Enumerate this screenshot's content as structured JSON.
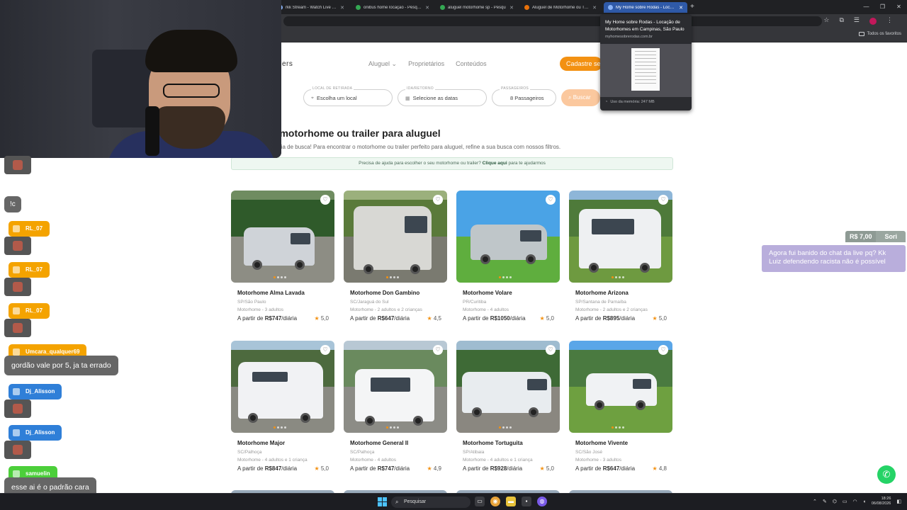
{
  "browser": {
    "tabs": [
      {
        "title": "rkk Stream - Watch Live on Ki",
        "favicon": "globe-icon"
      },
      {
        "title": "onibus home locação - Pesquis",
        "favicon": "google-icon"
      },
      {
        "title": "aluguel motorhome sp - Pesqu",
        "favicon": "google-icon"
      },
      {
        "title": "Aluguel de Motorhome ou Trail",
        "favicon": "site-icon"
      },
      {
        "title": "My Home sobre Rodas - Locaçã",
        "favicon": "globe-icon",
        "active": true
      }
    ],
    "bookmarks_all": "Todos os favoritos",
    "tab_preview": {
      "title": "My Home sobre Rodas - Locação de Motorhomes em Campinas, São Paulo",
      "url": "myhomesobrerodas.com.br",
      "memory": "Uso da memória: 247 MB"
    }
  },
  "site": {
    "logo_fragment": "ers",
    "nav": [
      "Aluguel",
      "Proprietários",
      "Conteúdos"
    ],
    "cta": "Cadastre seu",
    "search": {
      "location": {
        "label": "LOCAL DE RETIRADA",
        "value": "Escolha um local"
      },
      "dates": {
        "label": "IDA/RETORNO",
        "value": "Selecione as datas"
      },
      "passengers": {
        "label": "PASSAGEIROS",
        "value": "8 Passageiros"
      },
      "button": "Buscar"
    },
    "headline": "u motorhome ou trailer para aluguel",
    "subline": "iência de busca! Para encontrar o motorhome ou trailer perfeito para aluguel, refine a sua busca com nossos filtros.",
    "help": {
      "text": "Precisa de ajuda para escolher o seu motorhome ou trailer?",
      "link": "Clique aqui",
      "tail": "para te ajudarmos"
    },
    "price_prefix": "A partir de",
    "price_suffix": "/diária",
    "listings": [
      {
        "title": "Motorhome Alma Lavada",
        "location": "SP/São Paulo",
        "capacity": "Motorhome - 3 adultos",
        "price": "R$747",
        "rating": "5,0"
      },
      {
        "title": "Motorhome Don Gambino",
        "location": "SC/Jaraguá do Sul",
        "capacity": "Motorhome - 2 adultos e 2 crianças",
        "price": "R$647",
        "rating": "4,5"
      },
      {
        "title": "Motorhome Volare",
        "location": "PR/Curitiba",
        "capacity": "Motorhome - 4 adultos",
        "price": "R$1050",
        "rating": "5,0"
      },
      {
        "title": "Motorhome Arizona",
        "location": "SP/Santana de Parnaíba",
        "capacity": "Motorhome - 2 adultos e 2 crianças",
        "price": "R$895",
        "rating": "5,0"
      },
      {
        "title": "Motorhome Major",
        "location": "SC/Palhoça",
        "capacity": "Motorhome - 4 adultos e 1 criança",
        "price": "R$847",
        "rating": "5,0"
      },
      {
        "title": "Motorhome General II",
        "location": "SC/Palhoça",
        "capacity": "Motorhome - 4 adultos",
        "price": "R$747",
        "rating": "4,9"
      },
      {
        "title": "Motorhome Tortuguita",
        "location": "SP/Atibaia",
        "capacity": "Motorhome - 4 adultos e 1 criança",
        "price": "R$928",
        "rating": "5,0"
      },
      {
        "title": "Motorhome Vivente",
        "location": "SC/São José",
        "capacity": "Motorhome - 3 adultos",
        "price": "R$647",
        "rating": "4,8"
      }
    ]
  },
  "stream": {
    "chat": [
      {
        "type": "bubble",
        "text": "!c"
      },
      {
        "type": "user",
        "name": "RL_07",
        "color": "#f4a300"
      },
      {
        "type": "user",
        "name": "RL_07",
        "color": "#f4a300"
      },
      {
        "type": "user",
        "name": "RL_07",
        "color": "#f4a300"
      },
      {
        "type": "user",
        "name": "Umcara_qualquer69",
        "color": "#f4a300"
      },
      {
        "type": "bubble",
        "text": "gordão vale por 5, ja ta errado"
      },
      {
        "type": "user",
        "name": "Dj_Alisson",
        "color": "#2f7fd8"
      },
      {
        "type": "user",
        "name": "Dj_Alisson",
        "color": "#2f7fd8"
      },
      {
        "type": "user",
        "name": "samuelin",
        "color": "#4ccf3a"
      },
      {
        "type": "bubble",
        "text": "esse ai é o padrão cara"
      }
    ],
    "donation": {
      "amount": "R$ 7,00",
      "name": "Sori",
      "message": "Agora fui banido do chat da live pq? Kk Luiz defendendo racista não é possível"
    }
  },
  "taskbar": {
    "search": "Pesquisar",
    "time": "18:26",
    "date": "06/08/2026"
  }
}
